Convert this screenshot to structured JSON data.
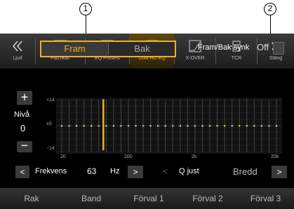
{
  "callouts": {
    "c1": "1",
    "c2": "2"
  },
  "topbar": {
    "items": [
      {
        "label": "Ljud",
        "icon": "double-chevron-left-icon"
      },
      {
        "label": "Fad./Bal.",
        "icon": "fader-balance-icon"
      },
      {
        "label": "EQ Presets",
        "icon": "eq-presets-icon"
      },
      {
        "label": "Dual HD EQ",
        "icon": "dual-hd-eq-icon"
      },
      {
        "label": "X-OVER",
        "icon": "crossover-icon"
      },
      {
        "label": "TCR",
        "icon": "tcr-icon"
      },
      {
        "label": "Stäng",
        "icon": "close-icon"
      }
    ],
    "active_label": "Dual HD EQ"
  },
  "segment": {
    "fram": "Fram",
    "bak": "Bak"
  },
  "sync": {
    "label": "Fram/Bak synk",
    "value": "Off"
  },
  "level": {
    "plus": "+",
    "label": "Nivå",
    "value": "0",
    "minus": "−"
  },
  "graph": {
    "y_top": "+14",
    "y_mid": "±0",
    "y_bottom": "−14",
    "x_labels": [
      "20",
      "200",
      "2k",
      "20k"
    ],
    "selected_band_label": "63 Hz"
  },
  "controls": {
    "freq_label": "Frekvens",
    "freq_value": "63",
    "freq_unit": "Hz",
    "q_label": "Q just",
    "q_value": "Bredd",
    "prev": "<",
    "next": ">"
  },
  "presets": [
    "Rak",
    "Band",
    "Förval 1",
    "Förval 2",
    "Förval 3"
  ],
  "colors": {
    "accent": "#f0b020",
    "background": "#000000"
  }
}
